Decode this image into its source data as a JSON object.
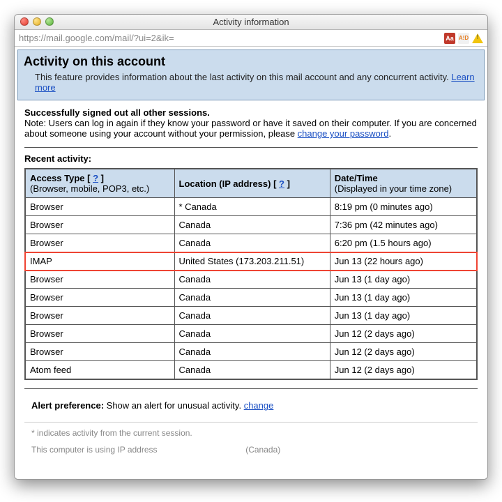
{
  "window": {
    "title": "Activity information",
    "url": "https://mail.google.com/mail/?ui=2&ik="
  },
  "header": {
    "title": "Activity on this account",
    "desc_prefix": "This feature provides information about the last activity on this mail account and any concurrent activity. ",
    "learn_more": "Learn more"
  },
  "signout": {
    "success": "Successfully signed out all other sessions.",
    "note_prefix": "Note: Users can log in again if they know your password or have it saved on their computer. If you are concerned about someone using your account without your permission, please ",
    "change_pw": "change your password",
    "period": "."
  },
  "recent": {
    "heading": "Recent activity:",
    "col1_line1_a": "Access Type [ ",
    "col1_q": "?",
    "col1_line1_b": " ]",
    "col1_line2": "(Browser, mobile, POP3, etc.)",
    "col2_line1_a": "Location (IP address) [ ",
    "col2_q": "?",
    "col2_line1_b": " ]",
    "col3_line1": "Date/Time",
    "col3_line2": "(Displayed in your time zone)",
    "rows": [
      {
        "type": "Browser",
        "loc": "* Canada",
        "time": "8:19 pm (0 minutes ago)",
        "hl": false
      },
      {
        "type": "Browser",
        "loc": "Canada",
        "time": "7:36 pm (42 minutes ago)",
        "hl": false
      },
      {
        "type": "Browser",
        "loc": "Canada",
        "time": "6:20 pm (1.5 hours ago)",
        "hl": false
      },
      {
        "type": "IMAP",
        "loc": "United States (173.203.211.51)",
        "time": "Jun 13 (22 hours ago)",
        "hl": true
      },
      {
        "type": "Browser",
        "loc": "Canada",
        "time": "Jun 13 (1 day ago)",
        "hl": false
      },
      {
        "type": "Browser",
        "loc": "Canada",
        "time": "Jun 13 (1 day ago)",
        "hl": false
      },
      {
        "type": "Browser",
        "loc": "Canada",
        "time": "Jun 13 (1 day ago)",
        "hl": false
      },
      {
        "type": "Browser",
        "loc": "Canada",
        "time": "Jun 12 (2 days ago)",
        "hl": false
      },
      {
        "type": "Browser",
        "loc": "Canada",
        "time": "Jun 12 (2 days ago)",
        "hl": false
      },
      {
        "type": "Atom feed",
        "loc": "Canada",
        "time": "Jun 12 (2 days ago)",
        "hl": false
      }
    ]
  },
  "alert": {
    "label": "Alert preference: ",
    "text": "Show an alert for unusual activity. ",
    "change": "change"
  },
  "footer": {
    "star_note": "* indicates activity from the current session.",
    "ip_line_a": "This computer is using IP address",
    "ip_line_b": "(Canada)"
  }
}
